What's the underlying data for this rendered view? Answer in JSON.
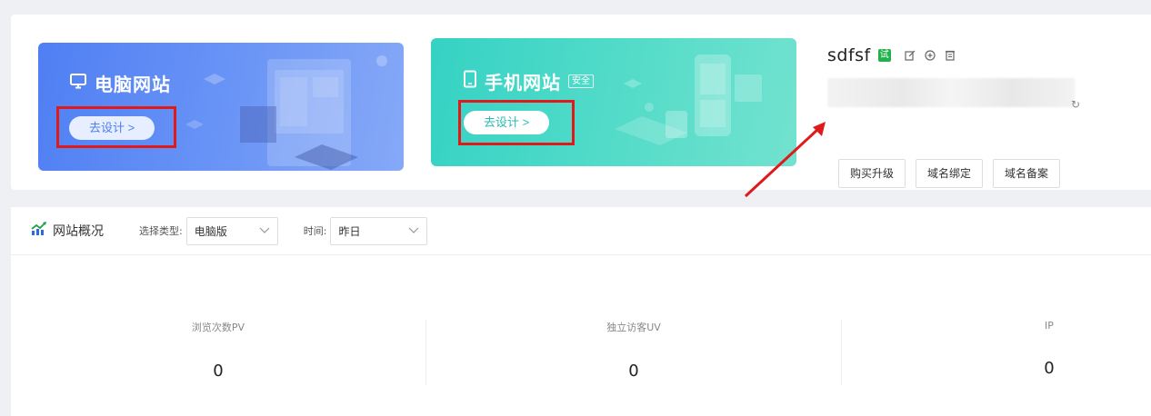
{
  "cards": {
    "pc": {
      "title": "电脑网站",
      "button": "去设计 >",
      "icon": "monitor-icon",
      "color": "#4f7ff3"
    },
    "mobile": {
      "title": "手机网站",
      "badge": "安全",
      "button": "去设计 >",
      "icon": "phone-icon",
      "color": "#35d2c4"
    }
  },
  "site": {
    "name": "sdfsf",
    "trial_badge": "试",
    "url_icon": "↻",
    "actions": [
      "购买升级",
      "域名绑定",
      "域名备案"
    ]
  },
  "overview": {
    "title": "网站概况",
    "type_label": "选择类型:",
    "type_value": "电脑版",
    "time_label": "时间:",
    "time_value": "昨日",
    "stats": [
      {
        "label": "浏览次数PV",
        "value": "0"
      },
      {
        "label": "独立访客UV",
        "value": "0"
      },
      {
        "label": "IP",
        "value": "0"
      }
    ]
  },
  "annotation_color": "#e0191b"
}
